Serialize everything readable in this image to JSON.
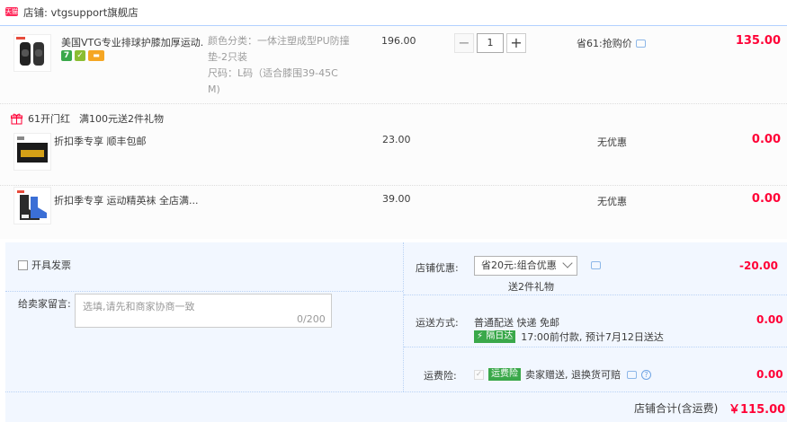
{
  "shop": {
    "prefix": "店铺:",
    "name": "vtgsupport旗舰店",
    "icon_text": "天猫"
  },
  "item": {
    "title": "美国VTG专业排球护膝加厚运动...",
    "sku_color": "颜色分类：一体注塑成型PU防撞",
    "sku_color_2": "垫-2只装",
    "sku_size": "尺码：L码（适合膝围39-45C",
    "sku_size_2": "M)",
    "price": "196.00",
    "qty": "1",
    "minus": "−",
    "plus": "+",
    "promo": "省61:抢购价",
    "total": "135.00",
    "badges": [
      {
        "icon": "seven-day-return-icon",
        "text": "7",
        "color": "#3aa84a"
      },
      {
        "icon": "genuine-icon",
        "text": "✓",
        "color": "#8bbd32"
      },
      {
        "icon": "card-payment-icon",
        "text": "▬",
        "color": "#f5a623"
      }
    ]
  },
  "gift_bar": {
    "icon": "gift-icon",
    "promo1": "61开门红",
    "promo2": "满100元送2件礼物"
  },
  "gifts": [
    {
      "title": "折扣季专享 顺丰包邮",
      "price": "23.00",
      "discount": "无优惠",
      "total": "0.00"
    },
    {
      "title": "折扣季专享 运动精英袜 全店满...",
      "price": "39.00",
      "discount": "无优惠",
      "total": "0.00"
    }
  ],
  "invoice": {
    "label": "开具发票"
  },
  "message": {
    "label": "给卖家留言:",
    "placeholder": "选填,请先和商家协商一致",
    "count": "0/200"
  },
  "shop_discount": {
    "label": "店铺优惠:",
    "selected": "省20元:组合优惠",
    "note": "送2件礼物",
    "amount": "-20.00"
  },
  "shipping": {
    "label": "运送方式:",
    "method": "普通配送 快递 免邮",
    "tag": "隔日达",
    "note": "17:00前付款, 预计7月12日送达",
    "amount": "0.00"
  },
  "insurance": {
    "label": "运费险:",
    "tag": "运费险",
    "note": "卖家赠送, 退换货可赔",
    "amount": "0.00"
  },
  "summary": {
    "label": "店铺合计(含运费)",
    "amount": "￥115.00"
  },
  "colors": {
    "accent_red": "#ff0036",
    "border_blue": "#b2d1ff",
    "panel_bg": "#f2f7ff",
    "green": "#3aa84a"
  }
}
